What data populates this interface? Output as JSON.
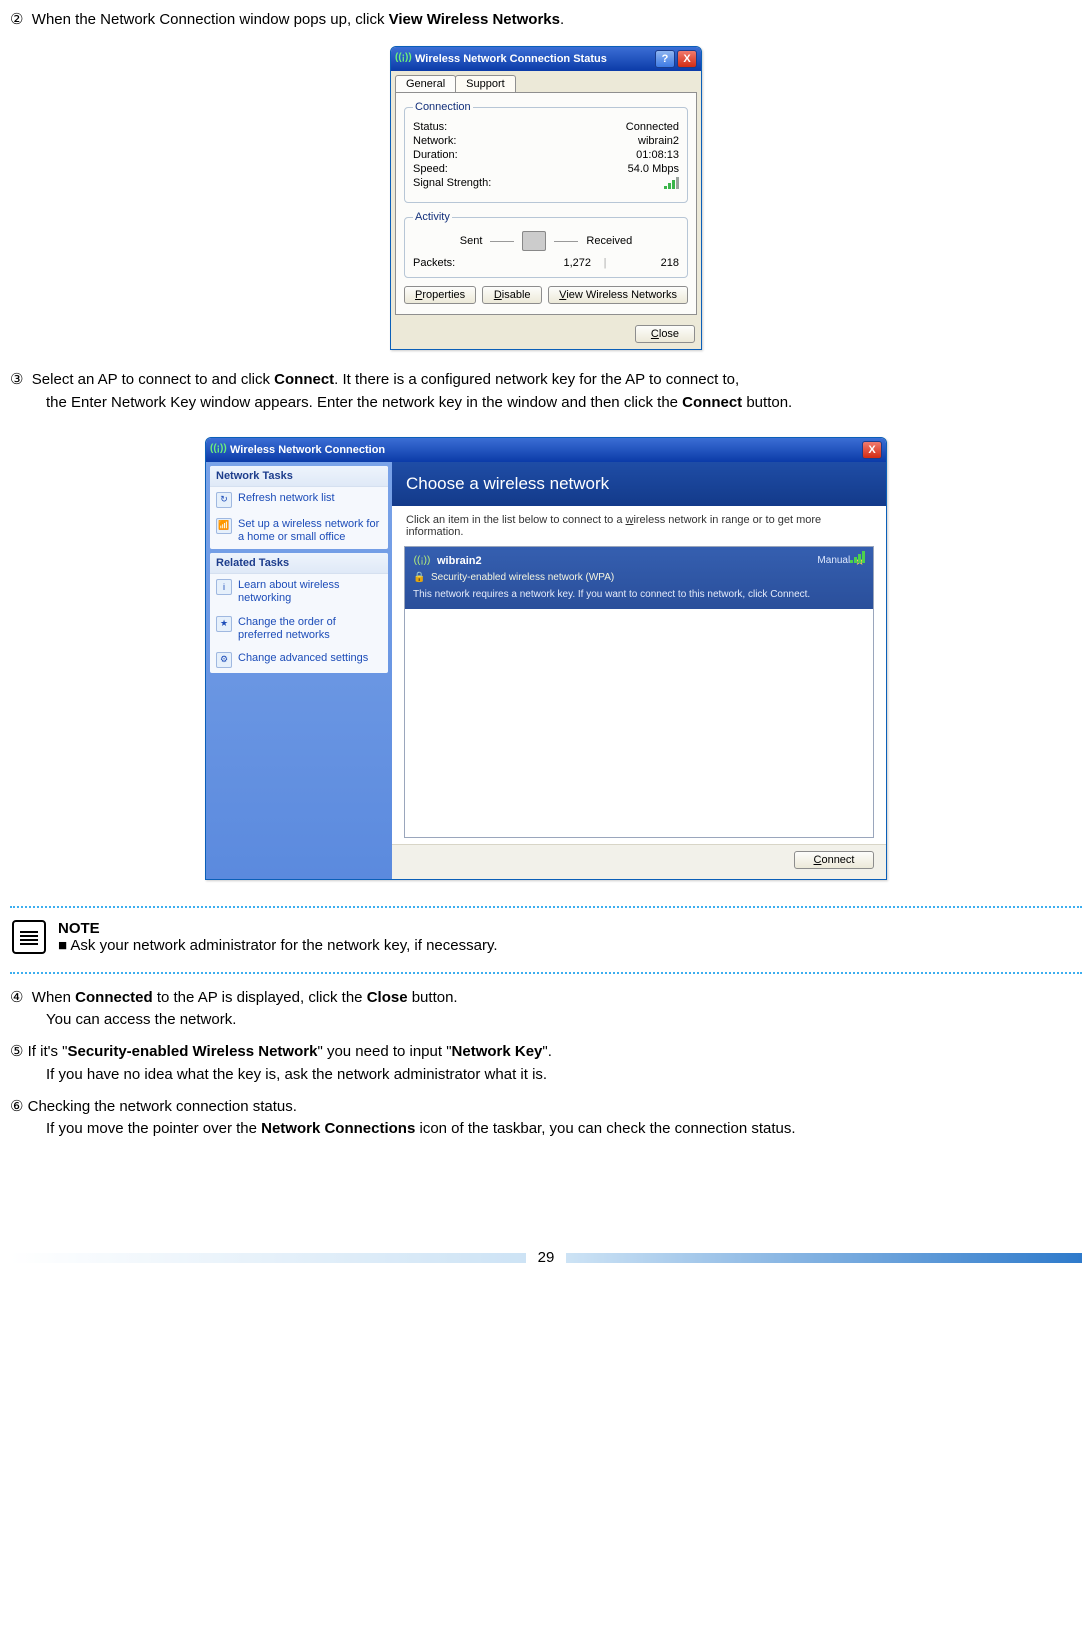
{
  "instructions": {
    "step2": {
      "num": "②",
      "pre": "When the Network Connection window pops up, click ",
      "bold": "View Wireless Networks",
      "post": "."
    },
    "step3": {
      "num": "③",
      "pre": "Select an AP to connect to and click ",
      "bold1": "Connect",
      "mid": ". It there is a configured network key for the AP to connect to,",
      "line2_pre": "the Enter Network Key window appears. Enter the network key in the window and then click the ",
      "bold2": "Connect",
      "line2_post": " button."
    },
    "step4": {
      "num": "④",
      "pre": "When ",
      "bold1": "Connected",
      "mid": " to the AP is displayed, click the ",
      "bold2": "Close",
      "post": " button.",
      "line2": "You can access the network."
    },
    "step5": {
      "num": "⑤",
      "pre": " If it's \"",
      "bold1": "Security-enabled Wireless Network",
      "mid": "\" you need to input \"",
      "bold2": "Network Key",
      "post": "\".",
      "line2": "If you have no idea what the key is, ask the network administrator what it is."
    },
    "step6": {
      "num": "⑥",
      "line1": " Checking the network connection status.",
      "line2_pre": "If you move the pointer over the ",
      "bold": "Network Connections",
      "line2_post": " icon of the taskbar, you can check the connection status."
    }
  },
  "status_dialog": {
    "title": "Wireless Network Connection Status",
    "tabs": {
      "general": "General",
      "support": "Support"
    },
    "connection": {
      "legend": "Connection",
      "status_label": "Status:",
      "status_value": "Connected",
      "network_label": "Network:",
      "network_value": "wibrain2",
      "duration_label": "Duration:",
      "duration_value": "01:08:13",
      "speed_label": "Speed:",
      "speed_value": "54.0 Mbps",
      "signal_label": "Signal Strength:"
    },
    "activity": {
      "legend": "Activity",
      "sent_label": "Sent",
      "received_label": "Received",
      "packets_label": "Packets:",
      "sent_value": "1,272",
      "received_value": "218"
    },
    "buttons": {
      "properties": "Properties",
      "disable": "Disable",
      "view": "View Wireless Networks",
      "close": "Close"
    }
  },
  "wifi_dialog": {
    "title": "Wireless Network Connection",
    "sidebar": {
      "tasks_head": "Network Tasks",
      "refresh": "Refresh network list",
      "setup": "Set up a wireless network for a home or small office",
      "related_head": "Related Tasks",
      "learn": "Learn about wireless networking",
      "order": "Change the order of preferred networks",
      "advanced": "Change advanced settings"
    },
    "main": {
      "heading": "Choose a wireless network",
      "hint": "Click an item in the list below to connect to a wireless network in range or to get more information.",
      "net": {
        "ssid": "wibrain2",
        "mode": "Manual",
        "security": "Security-enabled wireless network (WPA)",
        "desc": "This network requires a network key. If you want to connect to this network, click Connect."
      },
      "connect": "Connect"
    }
  },
  "note": {
    "heading": "NOTE",
    "body": "■ Ask your network administrator for the network key, if necessary."
  },
  "page_number": "29"
}
